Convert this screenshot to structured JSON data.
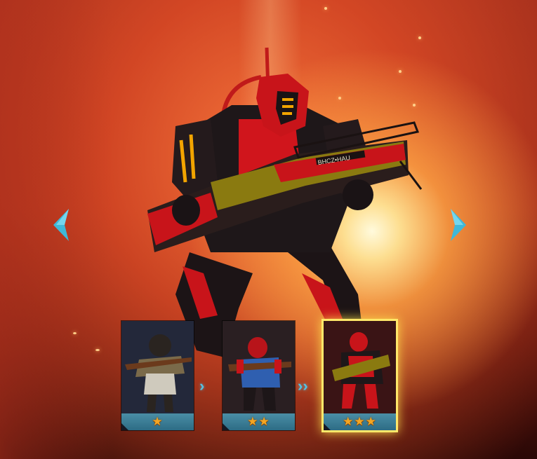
{
  "hero": {
    "name_icon": "armored-soldier-heavy-gun",
    "gun_text": "BHCZ•HAU"
  },
  "navigation": {
    "left_icon": "chevron-left-icon",
    "right_icon": "chevron-right-icon",
    "accent_color": "#3fb8d8"
  },
  "tiers": [
    {
      "stars": "★",
      "star_count": 1,
      "selected": false,
      "portrait_icon": "soldier-tier1-icon"
    },
    {
      "stars": "★★",
      "star_count": 2,
      "selected": false,
      "portrait_icon": "soldier-tier2-icon"
    },
    {
      "stars": "★★★",
      "star_count": 3,
      "selected": true,
      "portrait_icon": "soldier-tier3-icon"
    }
  ],
  "connectors": [
    {
      "glyph": "›"
    },
    {
      "glyph": "››"
    }
  ],
  "colors": {
    "star": "#f5a623",
    "selected_outline": "#ffe86a",
    "card_bar": "#3a7f98"
  }
}
